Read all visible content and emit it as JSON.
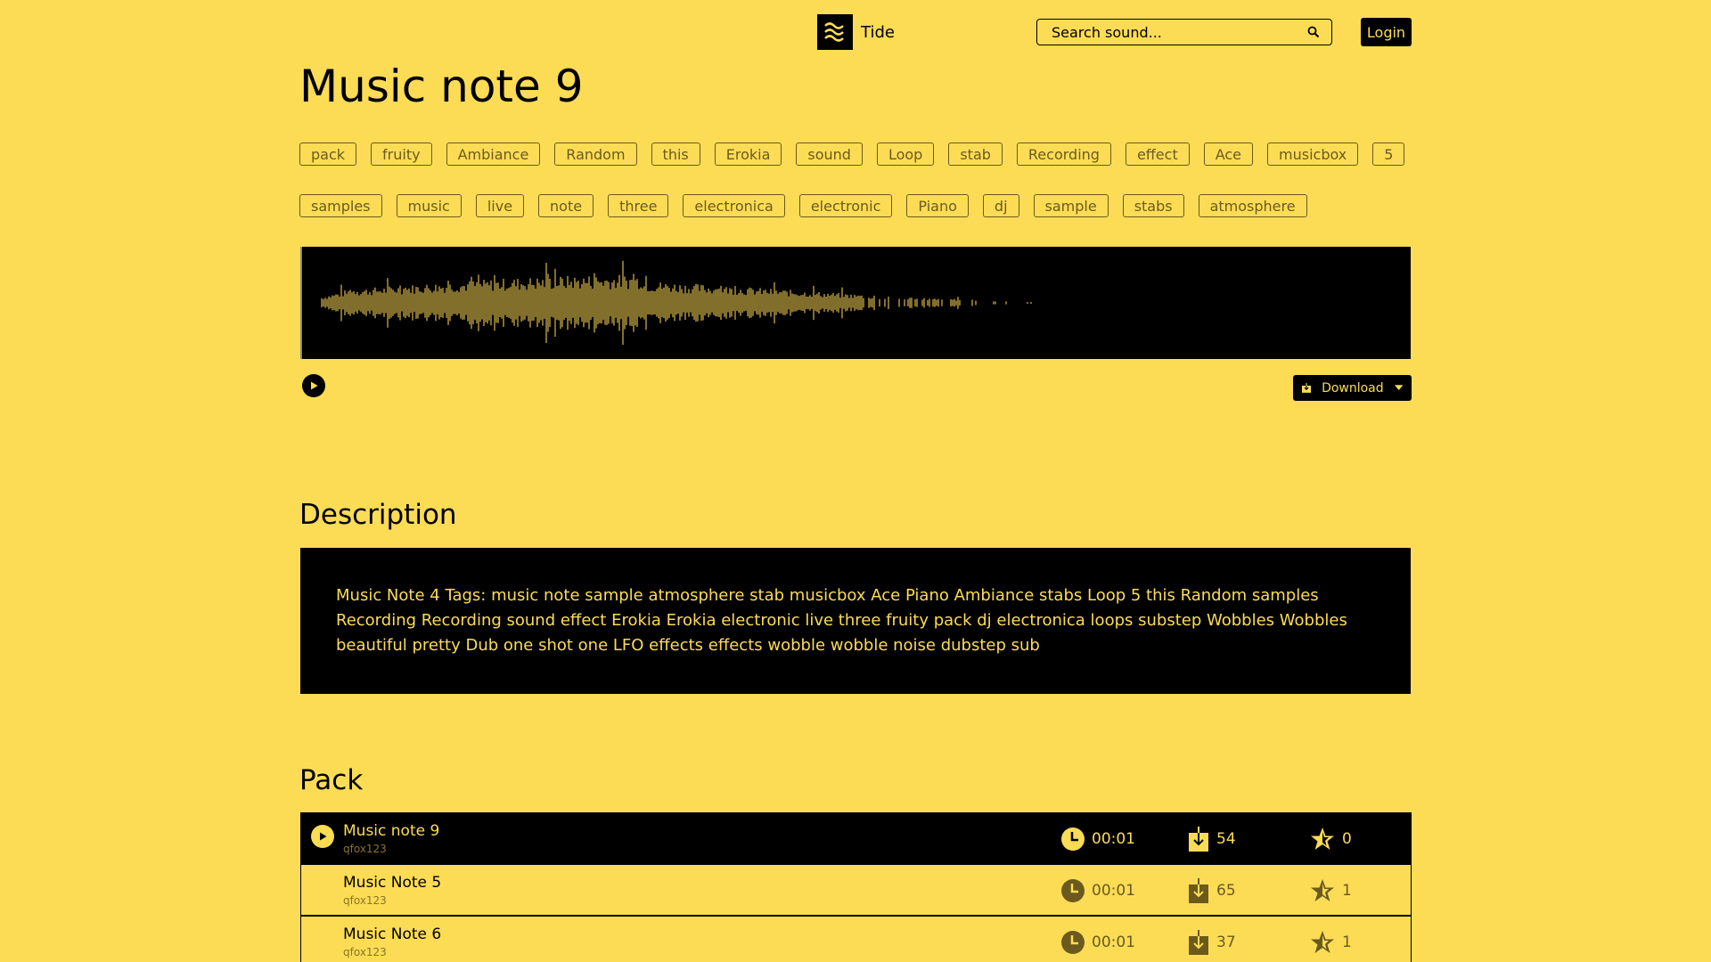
{
  "header": {
    "app_name": "Tide",
    "logo_icon": "waves-icon",
    "search": {
      "placeholder": "Search sound...",
      "value": ""
    },
    "login_label": "Login"
  },
  "sound": {
    "title": "Music note 9",
    "tags": [
      "pack",
      "fruity",
      "Ambiance",
      "Random",
      "this",
      "Erokia",
      "sound",
      "Loop",
      "stab",
      "Recording",
      "effect",
      "Ace",
      "musicbox",
      "5",
      "samples",
      "music",
      "live",
      "note",
      "three",
      "electronica",
      "electronic",
      "Piano",
      "dj",
      "sample",
      "stabs",
      "atmosphere"
    ],
    "download_label": "Download",
    "colors": {
      "background": "#fcdc55",
      "dark": "#000000",
      "muted": "#6b5a1c"
    }
  },
  "description": {
    "heading": "Description",
    "text": "Music Note 4 Tags: music note sample atmosphere stab musicbox Ace Piano Ambiance stabs Loop 5 this Random samples Recording Recording sound effect Erokia Erokia electronic live three fruity pack dj electronica loops substep Wobbles Wobbles beautiful pretty Dub one shot one LFO effects effects wobble wobble noise dubstep sub"
  },
  "pack": {
    "heading": "Pack",
    "items": [
      {
        "name": "Music note 9",
        "user": "qfox123",
        "duration": "00:01",
        "downloads": "54",
        "rating": "0",
        "active": true
      },
      {
        "name": "Music Note 5",
        "user": "qfox123",
        "duration": "00:01",
        "downloads": "65",
        "rating": "1",
        "active": false
      },
      {
        "name": "Music Note 6",
        "user": "qfox123",
        "duration": "00:01",
        "downloads": "37",
        "rating": "1",
        "active": false
      }
    ]
  }
}
